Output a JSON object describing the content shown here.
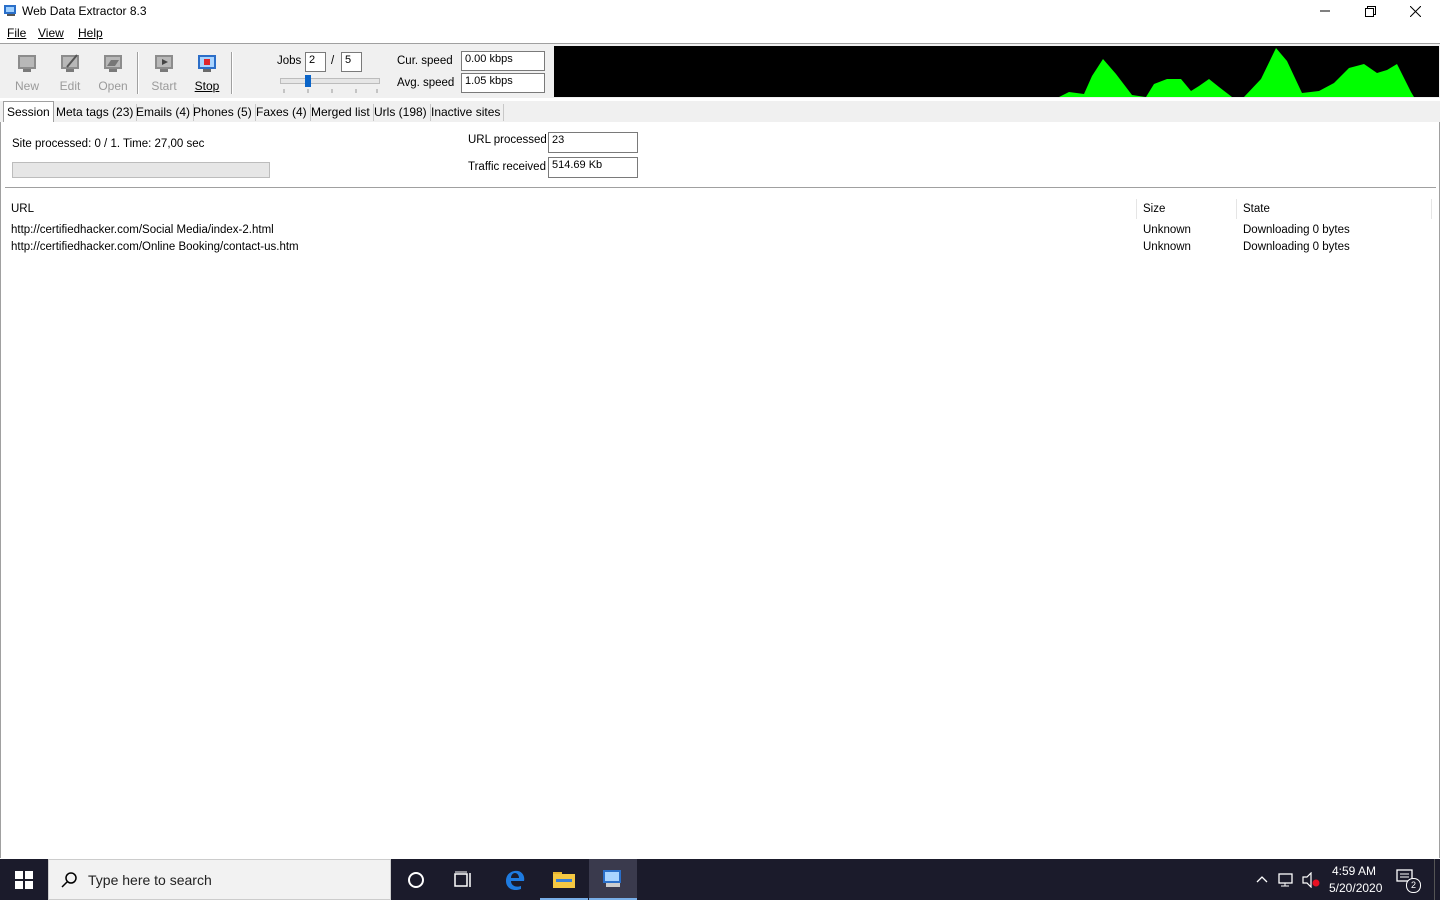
{
  "window": {
    "title": "Web Data Extractor 8.3"
  },
  "menu": {
    "file": "File",
    "view": "View",
    "help": "Help"
  },
  "toolbar": {
    "new_label": "New",
    "edit_label": "Edit",
    "open_label": "Open",
    "start_label": "Start",
    "stop_label": "Stop",
    "jobs_label": "Jobs",
    "jobs_value": "2",
    "jobs_sep": "/",
    "jobs_max": "5",
    "jobs_slider_fraction": 0.25,
    "cur_speed_label": "Cur. speed",
    "cur_speed_value": "0.00 kbps",
    "avg_speed_label": "Avg. speed",
    "avg_speed_value": "1.05 kbps"
  },
  "traffic_graph": {
    "color": "#00ff00",
    "background": "#000000"
  },
  "tabs": [
    {
      "label": "Session",
      "selected": true
    },
    {
      "label": "Meta tags (23)"
    },
    {
      "label": "Emails (4)"
    },
    {
      "label": "Phones (5)"
    },
    {
      "label": "Faxes (4)"
    },
    {
      "label": "Merged list"
    },
    {
      "label": "Urls (198)"
    },
    {
      "label": "Inactive sites"
    }
  ],
  "session": {
    "site_processed": "Site processed: 0 / 1. Time: 27,00 sec",
    "progress_fraction": 0,
    "url_processed_label": "URL processed",
    "url_processed_value": "23",
    "traffic_received_label": "Traffic received",
    "traffic_received_value": "514.69 Kb"
  },
  "table": {
    "columns": [
      "URL",
      "Size",
      "State"
    ],
    "rows": [
      [
        "http://certifiedhacker.com/Social Media/index-2.html",
        "Unknown",
        "Downloading 0 bytes"
      ],
      [
        "http://certifiedhacker.com/Online Booking/contact-us.htm",
        "Unknown",
        "Downloading 0 bytes"
      ]
    ]
  },
  "taskbar": {
    "search_placeholder": "Type here to search",
    "time": "4:59 AM",
    "date": "5/20/2020",
    "notification_count": "2"
  }
}
